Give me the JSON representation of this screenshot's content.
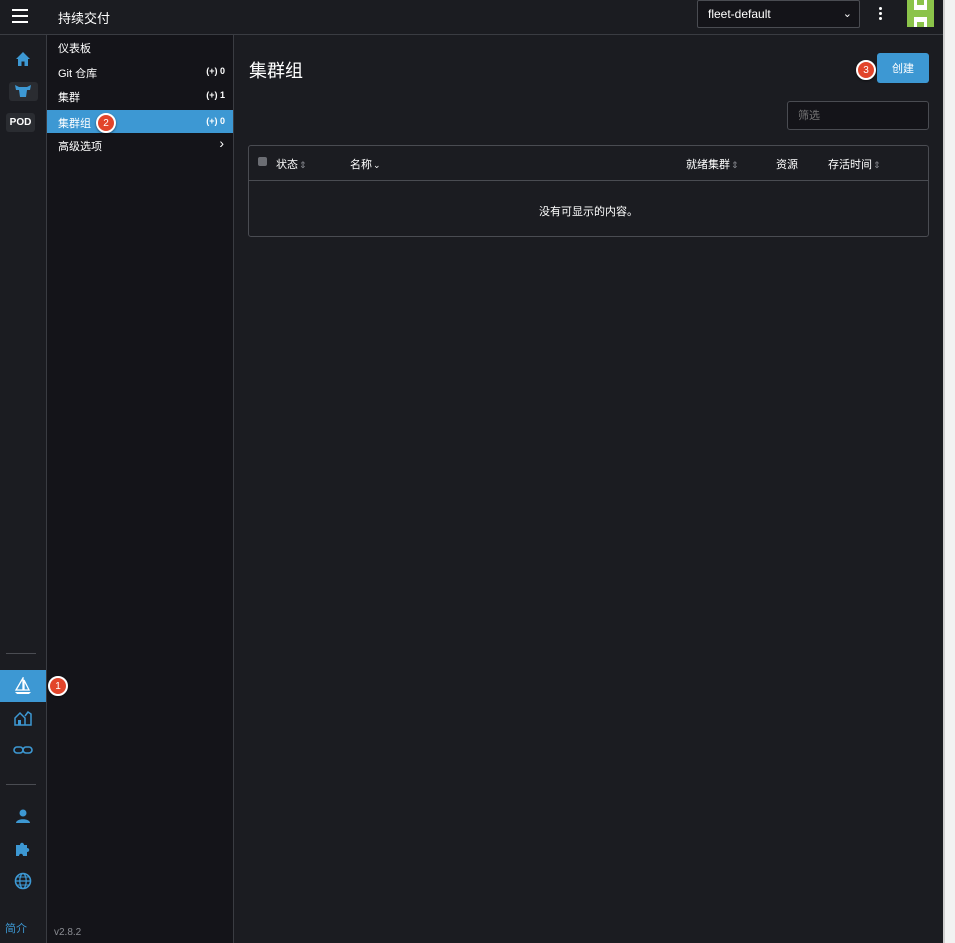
{
  "header": {
    "title": "持续交付",
    "workspace_selected": "fleet-default"
  },
  "leftnav": {
    "pod_label": "POD",
    "about_label": "简介"
  },
  "submenu": {
    "items": [
      {
        "label": "仪表板",
        "count": ""
      },
      {
        "label": "Git 仓库",
        "count": "0"
      },
      {
        "label": "集群",
        "count": "1"
      },
      {
        "label": "集群组",
        "count": "0"
      },
      {
        "label": "高级选项",
        "count": ""
      }
    ],
    "version": "v2.8.2"
  },
  "main": {
    "title": "集群组",
    "create_label": "创建",
    "filter_placeholder": "筛选",
    "columns": [
      "状态",
      "名称",
      "就绪集群",
      "资源",
      "存活时间"
    ],
    "empty_text": "没有可显示的内容。"
  },
  "annotations": [
    "1",
    "2",
    "3"
  ],
  "colors": {
    "accent": "#3d98d3",
    "background": "#1b1c21",
    "submenu_bg": "#141419",
    "badge": "#e2452b"
  }
}
